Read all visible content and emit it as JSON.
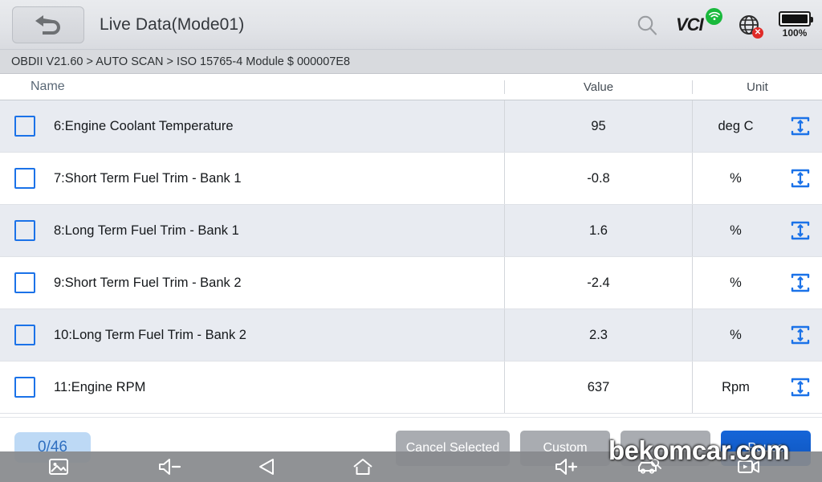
{
  "header": {
    "title": "Live Data(Mode01)",
    "back_icon": "back-arrow-icon",
    "search_icon": "search-icon",
    "vci_label": "VCI",
    "vci_icon": "vci-wifi-icon",
    "globe_icon": "globe-disconnected-icon",
    "globe_badge": "✕",
    "battery_icon": "battery-full-icon",
    "battery_percent": "100%"
  },
  "breadcrumb": {
    "text": "OBDII V21.60 > AUTO SCAN  > ISO 15765-4 Module $ 000007E8"
  },
  "table": {
    "columns": [
      "Name",
      "Value",
      "Unit"
    ],
    "graph_icon": "expand-vertical-icon",
    "rows": [
      {
        "name": "6:Engine Coolant Temperature",
        "value": "95",
        "unit": "deg C",
        "checked": false
      },
      {
        "name": "7:Short Term Fuel Trim - Bank 1",
        "value": "-0.8",
        "unit": "%",
        "checked": false
      },
      {
        "name": "8:Long Term Fuel Trim - Bank 1",
        "value": "1.6",
        "unit": "%",
        "checked": false
      },
      {
        "name": "9:Short Term Fuel Trim - Bank 2",
        "value": "-2.4",
        "unit": "%",
        "checked": false
      },
      {
        "name": "10:Long Term Fuel Trim - Bank 2",
        "value": "2.3",
        "unit": "%",
        "checked": false
      },
      {
        "name": "11:Engine RPM",
        "value": "637",
        "unit": "Rpm",
        "checked": false
      }
    ]
  },
  "footer": {
    "count_badge": "0/46",
    "buttons": [
      {
        "label": "Cancel Selected",
        "style": "secondary"
      },
      {
        "label": "Custom",
        "style": "secondary"
      },
      {
        "label": "",
        "style": "secondary"
      },
      {
        "label": "Pause",
        "style": "primary"
      }
    ]
  },
  "navbar": {
    "screenshot_icon": "screenshot-icon",
    "volume_down_icon": "volume-down-icon",
    "back_icon": "triangle-back-icon",
    "home_icon": "home-icon",
    "volume_up_icon": "volume-up-icon",
    "car_scan_icon": "car-scan-icon",
    "record_icon": "screen-record-icon"
  },
  "watermark": {
    "text": "bekomcar.com"
  },
  "colors": {
    "accent_blue": "#1b72e8",
    "primary_button": "#1565d8",
    "row_alt": "#e8ebf1",
    "header_bg": "#e2e4e8",
    "breadcrumb_bg": "#d8dade",
    "wifi_green": "#19b93c",
    "error_red": "#e02b28",
    "badge_bg": "#bdd9f5"
  }
}
